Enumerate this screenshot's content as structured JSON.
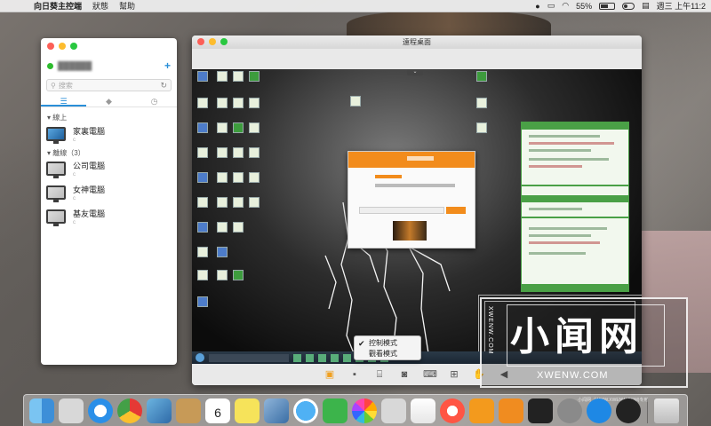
{
  "menubar": {
    "apple": "",
    "app_name": "向日葵主控端",
    "menus": [
      "狀態",
      "幫助"
    ],
    "battery_text": "55%",
    "datetime": "週三 上午11:2"
  },
  "sidepanel": {
    "search_placeholder": "搜索",
    "group_online": "▾ 線上",
    "group_offline": "▾ 離線（3）",
    "devices_online": [
      {
        "name": "家裏電腦",
        "sub": "c"
      }
    ],
    "devices_offline": [
      {
        "name": "公司電腦",
        "sub": "c"
      },
      {
        "name": "女神電腦",
        "sub": "c"
      },
      {
        "name": "基友電腦",
        "sub": "c"
      }
    ]
  },
  "remote_window": {
    "title": "遠程桌面",
    "mode_menu": {
      "items": [
        {
          "label": "控制模式",
          "checked": true
        },
        {
          "label": "觀看模式",
          "checked": false
        }
      ]
    }
  },
  "watermark": {
    "big": "小闻网",
    "small": "XWENW.COM",
    "vertical": "XWENW.COM",
    "url": "小闻网（WWW.XWENW.COM)专用"
  },
  "dock": {
    "calendar_day": "6"
  },
  "colors": {
    "accent": "#2a8fd8",
    "orange": "#f28c1c",
    "online": "#2dbb2d"
  }
}
